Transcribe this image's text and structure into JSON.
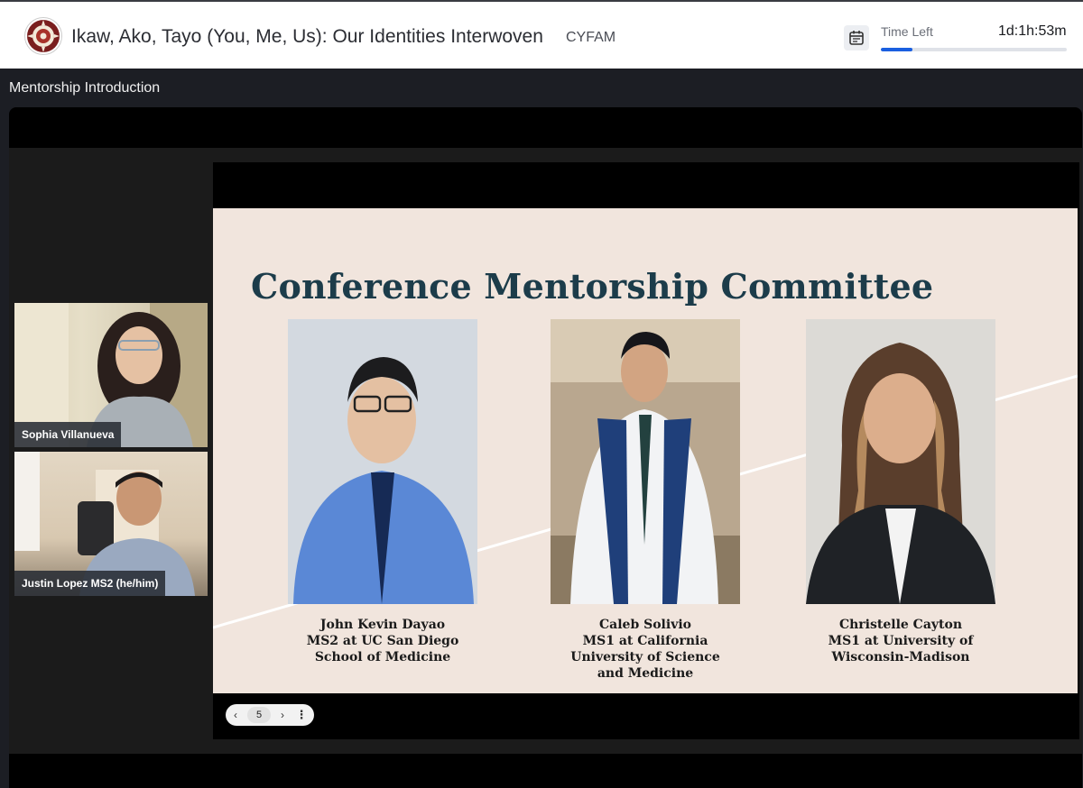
{
  "header": {
    "event_title": "Ikaw, Ako, Tayo (You, Me, Us): Our Identities Interwoven",
    "org": "CYFAM",
    "time_left_label": "Time Left",
    "time_left_value": "1d:1h:53m",
    "time_progress_fraction": 0.17,
    "accent_color": "#1a5fe0"
  },
  "session": {
    "title": "Mentorship Introduction"
  },
  "participants": [
    {
      "name": "Sophia Villanueva"
    },
    {
      "name": "Justin Lopez MS2 (he/him)"
    }
  ],
  "slide": {
    "title": "Conference Mentorship Committee",
    "mentors": [
      {
        "lines": [
          "John Kevin Dayao",
          "MS2 at UC San Diego",
          "School of Medicine"
        ]
      },
      {
        "lines": [
          "Caleb Solivio",
          "MS1 at California",
          "University of Science",
          "and Medicine"
        ]
      },
      {
        "lines": [
          "Christelle Cayton",
          "MS1 at University of",
          "Wisconsin-Madison"
        ]
      }
    ],
    "page_number": "5"
  },
  "icons": {
    "calendar": "calendar-icon",
    "prev": "chevron-left-icon",
    "next": "chevron-right-icon",
    "more": "more-vertical-icon"
  }
}
